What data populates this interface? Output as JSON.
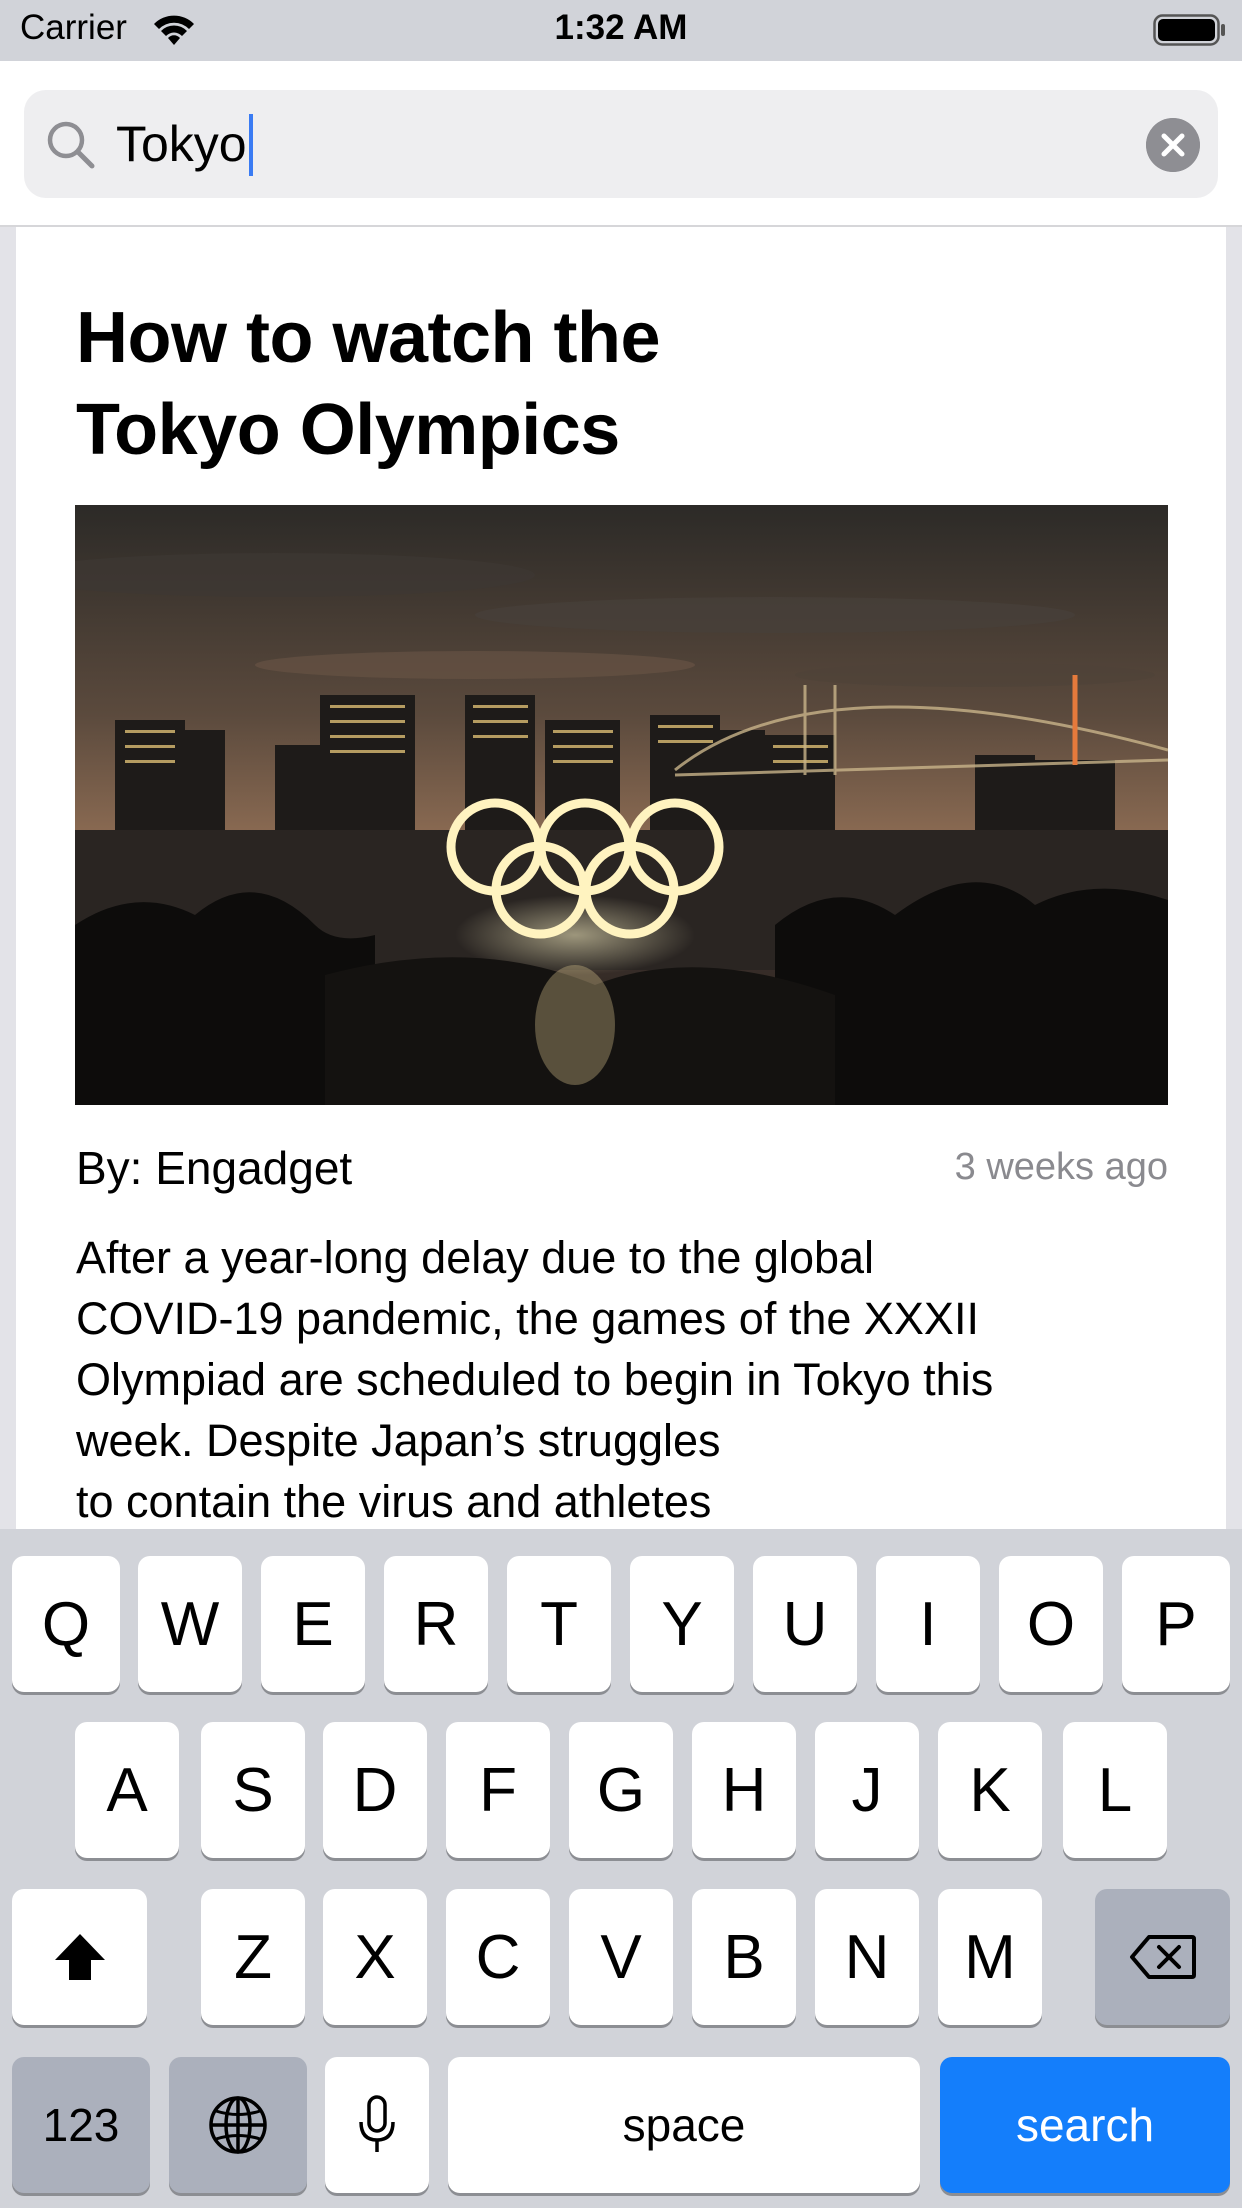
{
  "status_bar": {
    "carrier": "Carrier",
    "time": "1:32 AM"
  },
  "search": {
    "query": "Tokyo"
  },
  "article": {
    "title_line1": "How to watch the",
    "title_line2": "Tokyo Olympics",
    "byline": "By: Engadget",
    "time_ago": "3 weeks ago",
    "body": "After a year-long delay due to the global\nCOVID-19 pandemic, the games of the XXXII\nOlympiad are scheduled to begin in Tokyo this\nweek. Despite Japan’s struggles\n to contain the virus and athletes"
  },
  "keyboard": {
    "row1": [
      "Q",
      "W",
      "E",
      "R",
      "T",
      "Y",
      "U",
      "I",
      "O",
      "P"
    ],
    "row2": [
      "A",
      "S",
      "D",
      "F",
      "G",
      "H",
      "J",
      "K",
      "L"
    ],
    "row3": [
      "Z",
      "X",
      "C",
      "V",
      "B",
      "N",
      "M"
    ],
    "numbers_label": "123",
    "space_label": "space",
    "search_label": "search",
    "search_color": "#147efb",
    "icons": [
      "shift-icon",
      "backspace-icon",
      "globe-icon",
      "microphone-icon"
    ]
  }
}
